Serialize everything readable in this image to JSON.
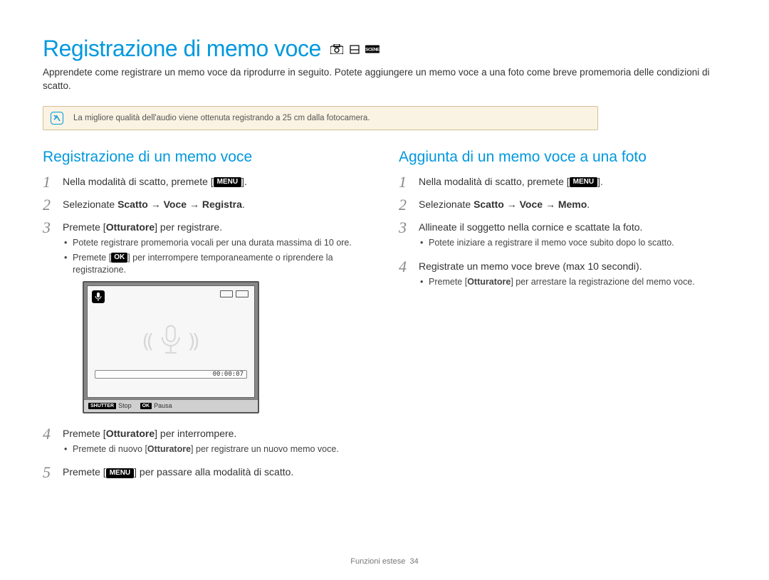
{
  "page_title": "Registrazione di memo voce",
  "intro": "Apprendete come registrare un memo voce da riprodurre in seguito. Potete aggiungere un memo voce a una foto come breve promemoria delle condizioni di scatto.",
  "note": "La migliore qualità dell'audio viene ottenuta registrando a 25 cm dalla fotocamera.",
  "left": {
    "heading": "Registrazione di un memo voce",
    "step1": {
      "pre": "Nella modalità di scatto, premete [",
      "btn": "MENU",
      "post": "]."
    },
    "step2_pre": "Selezionate ",
    "step2_bold": "Scatto → Voce → Registra",
    "step2_post": ".",
    "step3_pre": "Premete [",
    "step3_bold": "Otturatore",
    "step3_post": "] per registrare.",
    "step3_b1": "Potete registrare promemoria vocali per una durata massima di 10 ore.",
    "step3_b2_pre": "Premete [",
    "step3_b2_btn": "OK",
    "step3_b2_post": "] per interrompere temporaneamente o riprendere la registrazione.",
    "step4_pre": "Premete [",
    "step4_bold": "Otturatore",
    "step4_post": "] per interrompere.",
    "step4_b1_pre": "Premete di nuovo [",
    "step4_b1_bold": "Otturatore",
    "step4_b1_post": "] per registrare un nuovo memo voce.",
    "step5_pre": "Premete [",
    "step5_btn": "MENU",
    "step5_post": "] per passare alla modalità di scatto."
  },
  "right": {
    "heading": "Aggiunta di un memo voce a una foto",
    "step1": {
      "pre": "Nella modalità di scatto, premete [",
      "btn": "MENU",
      "post": "]."
    },
    "step2_pre": "Selezionate ",
    "step2_bold": "Scatto → Voce → Memo",
    "step2_post": ".",
    "step3": "Allineate il soggetto nella cornice e scattate la foto.",
    "step3_b1": "Potete iniziare a registrare il memo voce subito dopo lo scatto.",
    "step4": "Registrate un memo voce breve (max 10 secondi).",
    "step4_b1_pre": "Premete [",
    "step4_b1_bold": "Otturatore",
    "step4_b1_post": "] per arrestare la registrazione del memo voce."
  },
  "display": {
    "time": "00:00:07",
    "shutter_lbl": "SHUTTER",
    "stop": "Stop",
    "ok_lbl": "OK",
    "pause": "Pausa"
  },
  "footer": {
    "section": "Funzioni estese",
    "page": "34"
  }
}
